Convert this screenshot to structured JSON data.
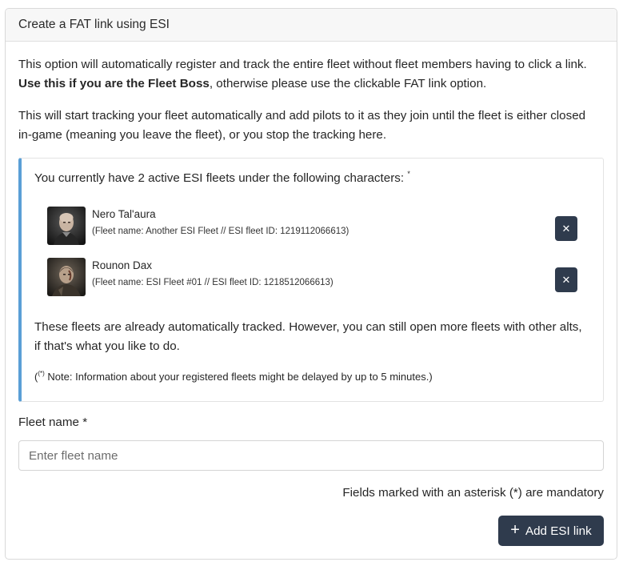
{
  "card": {
    "title": "Create a FAT link using ESI"
  },
  "intro": {
    "p1_before": "This option will automatically register and track the entire fleet without fleet members having to click a link. ",
    "p1_bold": "Use this if you are the Fleet Boss",
    "p1_after": ", otherwise please use the clickable FAT link option.",
    "p2": "This will start tracking your fleet automatically and add pilots to it as they join until the fleet is either closed in-game (meaning you leave the fleet), or you stop the tracking here."
  },
  "active_fleets": {
    "title": "You currently have 2 active ESI fleets under the following characters:",
    "title_marker": "*",
    "fleets": [
      {
        "character": "Nero Tal'aura",
        "details": "(Fleet name: Another ESI Fleet // ESI fleet ID: 1219112066613)",
        "remove_label": "✕"
      },
      {
        "character": "Rounon Dax",
        "details": "(Fleet name: ESI Fleet #01 // ESI fleet ID: 1218512066613)",
        "remove_label": "✕"
      }
    ],
    "tracked_text": "These fleets are already automatically tracked. However, you can still open more fleets with other alts, if that's what you like to do.",
    "note_open": "(",
    "note_marker": "(*)",
    "note_text": " Note: Information about your registered fleets might be delayed by up to 5 minutes.)"
  },
  "form": {
    "fleet_name_label": "Fleet name *",
    "fleet_name_placeholder": "Enter fleet name",
    "fleet_name_value": "",
    "mandatory_note": "Fields marked with an asterisk (*) are mandatory",
    "submit_icon": "plus-icon",
    "submit_label": "Add ESI link"
  },
  "colors": {
    "accent_border": "#5a9fd6",
    "button_bg": "#2f3b4d"
  }
}
